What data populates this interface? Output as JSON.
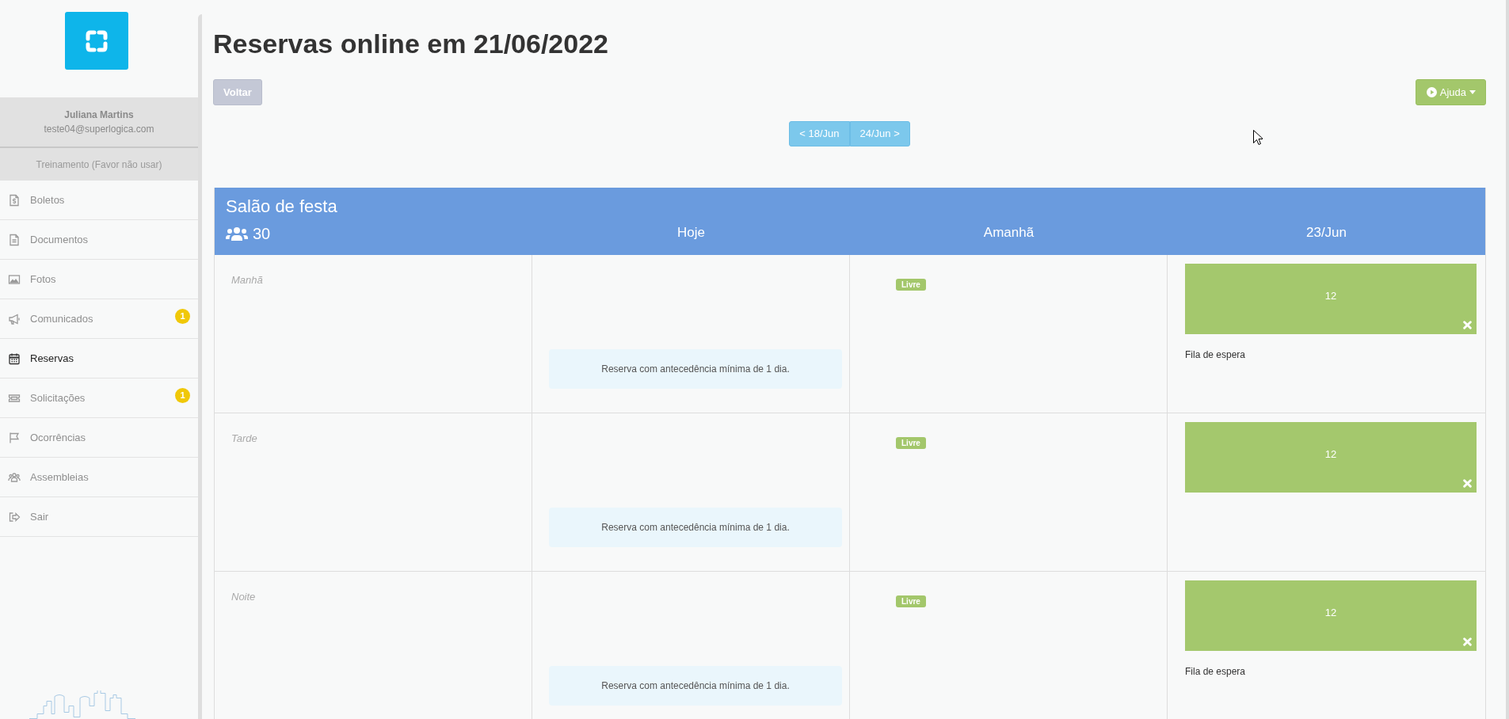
{
  "sidebar": {
    "user": {
      "name": "Juliana Martins",
      "email": "teste04@superlogica.com"
    },
    "condo": "Treinamento (Favor não usar)",
    "items": [
      {
        "label": "Boletos",
        "selected": false
      },
      {
        "label": "Documentos",
        "selected": false
      },
      {
        "label": "Fotos",
        "selected": false
      },
      {
        "label": "Comunicados",
        "selected": false,
        "badge": "1"
      },
      {
        "label": "Reservas",
        "selected": true
      },
      {
        "label": "Solicitações",
        "selected": false,
        "badge": "1"
      },
      {
        "label": "Ocorrências",
        "selected": false
      },
      {
        "label": "Assembleias",
        "selected": false
      },
      {
        "label": "Sair",
        "selected": false
      }
    ]
  },
  "title": "Reservas online em 21/06/2022",
  "back_button": "Voltar",
  "help_button": "Ajuda",
  "pager": [
    "< 18/Jun",
    "24/Jun >"
  ],
  "calendar": {
    "venue": "Salão de festa",
    "capacity": "30",
    "columns": [
      "Hoje",
      "Amanhã",
      "23/Jun"
    ],
    "rows": [
      {
        "period": "Manhã",
        "cells": [
          {
            "kind": "notice",
            "text": "Reserva com antecedência mínima de 1 dia."
          },
          {
            "kind": "free",
            "badge": "Livre"
          },
          {
            "kind": "booked",
            "unit": "12",
            "note": "Fila de espera"
          }
        ]
      },
      {
        "period": "Tarde",
        "cells": [
          {
            "kind": "notice",
            "text": "Reserva com antecedência mínima de 1 dia."
          },
          {
            "kind": "free",
            "badge": "Livre"
          },
          {
            "kind": "booked",
            "unit": "12"
          }
        ]
      },
      {
        "period": "Noite",
        "cells": [
          {
            "kind": "notice",
            "text": "Reserva com antecedência mínima de 1 dia."
          },
          {
            "kind": "free",
            "badge": "Livre"
          },
          {
            "kind": "booked",
            "unit": "12",
            "note": "Fila de espera"
          }
        ]
      }
    ]
  }
}
